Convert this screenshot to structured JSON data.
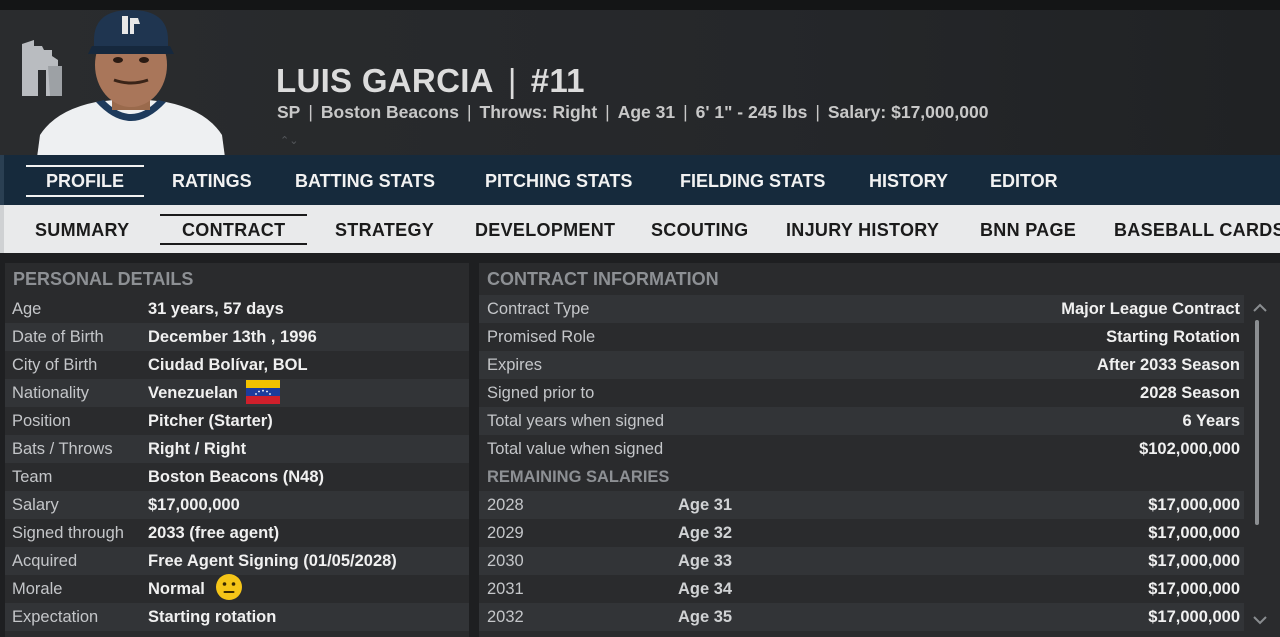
{
  "player": {
    "name": "LUIS GARCIA",
    "number": "#11",
    "position": "SP",
    "team": "Boston Beacons",
    "throws": "Throws: Right",
    "age": "Age 31",
    "height_weight": "6' 1\"  - 245 lbs",
    "salary": "Salary: $17,000,000",
    "carets": "⌃⌄"
  },
  "main_tabs": [
    "PROFILE",
    "RATINGS",
    "BATTING STATS",
    "PITCHING STATS",
    "FIELDING STATS",
    "HISTORY",
    "EDITOR"
  ],
  "sub_tabs": [
    "SUMMARY",
    "CONTRACT",
    "STRATEGY",
    "DEVELOPMENT",
    "SCOUTING",
    "INJURY HISTORY",
    "BNN PAGE",
    "BASEBALL CARDS"
  ],
  "personal": {
    "title": "PERSONAL DETAILS",
    "rows": [
      {
        "label": "Age",
        "value": "31 years, 57 days"
      },
      {
        "label": "Date of Birth",
        "value": "December 13th , 1996"
      },
      {
        "label": "City of Birth",
        "value": "Ciudad Bolívar, BOL"
      },
      {
        "label": "Nationality",
        "value": "Venezuelan"
      },
      {
        "label": "Position",
        "value": "Pitcher (Starter)"
      },
      {
        "label": "Bats / Throws",
        "value": "Right / Right"
      },
      {
        "label": "Team",
        "value": "Boston Beacons (N48)"
      },
      {
        "label": "Salary",
        "value": "$17,000,000"
      },
      {
        "label": "Signed through",
        "value": "2033 (free agent)"
      },
      {
        "label": "Acquired",
        "value": "Free Agent Signing (01/05/2028)"
      },
      {
        "label": "Morale",
        "value": "Normal"
      },
      {
        "label": "Expectation",
        "value": "Starting rotation"
      }
    ]
  },
  "contract": {
    "title": "CONTRACT INFORMATION",
    "rows": [
      {
        "label": "Contract Type",
        "value": "Major League Contract"
      },
      {
        "label": "Promised Role",
        "value": "Starting Rotation"
      },
      {
        "label": "Expires",
        "value": "After 2033 Season"
      },
      {
        "label": "Signed prior to",
        "value": "2028 Season"
      },
      {
        "label": "Total years when signed",
        "value": "6 Years"
      },
      {
        "label": "Total value when signed",
        "value": "$102,000,000"
      }
    ],
    "remaining_title": "REMAINING SALARIES",
    "salaries": [
      {
        "year": "2028",
        "age": "Age 31",
        "amount": "$17,000,000"
      },
      {
        "year": "2029",
        "age": "Age 32",
        "amount": "$17,000,000"
      },
      {
        "year": "2030",
        "age": "Age 33",
        "amount": "$17,000,000"
      },
      {
        "year": "2031",
        "age": "Age 34",
        "amount": "$17,000,000"
      },
      {
        "year": "2032",
        "age": "Age 35",
        "amount": "$17,000,000"
      }
    ]
  },
  "icons": {
    "team_logo": "beacons-logo-icon",
    "flag": "venezuela-flag-icon",
    "morale": "neutral-face-icon",
    "scroll_up": "chevron-up-icon",
    "scroll_down": "chevron-down-icon"
  },
  "colors": {
    "main_tab_bg": "#162a3c",
    "sub_tab_bg": "#e9eaeb",
    "panel_bg": "#2a2b2d",
    "row_alt": "#323437"
  },
  "scroll": {
    "up": "^",
    "down": "v"
  }
}
